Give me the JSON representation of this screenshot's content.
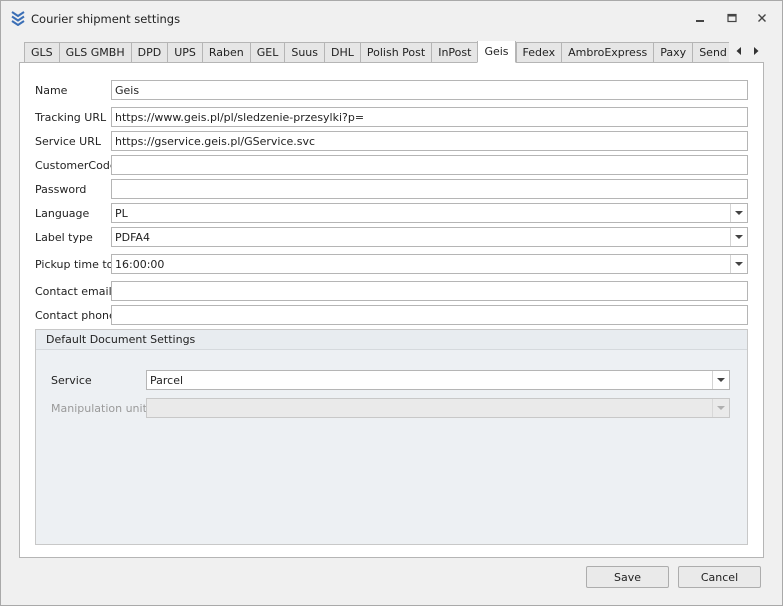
{
  "window": {
    "title": "Courier shipment settings",
    "icon": "chevron-stack-icon",
    "accent": "#3b6fb6"
  },
  "tabs": [
    {
      "label": "GLS"
    },
    {
      "label": "GLS GMBH"
    },
    {
      "label": "DPD"
    },
    {
      "label": "UPS"
    },
    {
      "label": "Raben"
    },
    {
      "label": "GEL"
    },
    {
      "label": "Suus"
    },
    {
      "label": "DHL"
    },
    {
      "label": "Polish Post"
    },
    {
      "label": "InPost"
    },
    {
      "label": "Geis",
      "active": true
    },
    {
      "label": "Fedex"
    },
    {
      "label": "AmbroExpress"
    },
    {
      "label": "Paxy"
    },
    {
      "label": "Send notifi"
    }
  ],
  "form": {
    "name": {
      "label": "Name",
      "value": "Geis"
    },
    "tracking_url": {
      "label": "Tracking URL",
      "value": "https://www.geis.pl/pl/sledzenie-przesylki?p="
    },
    "service_url": {
      "label": "Service URL",
      "value": "https://gservice.geis.pl/GService.svc"
    },
    "customer_code": {
      "label": "CustomerCode",
      "value": ""
    },
    "password": {
      "label": "Password",
      "value": ""
    },
    "language": {
      "label": "Language",
      "value": "PL"
    },
    "label_type": {
      "label": "Label type",
      "value": "PDFA4"
    },
    "pickup_time": {
      "label": "Pickup time to",
      "value": "16:00:00"
    },
    "contact_email": {
      "label": "Contact email",
      "value": ""
    },
    "contact_phone": {
      "label": "Contact phone",
      "value": ""
    }
  },
  "document_settings": {
    "header": "Default Document Settings",
    "service": {
      "label": "Service",
      "value": "Parcel"
    },
    "manipulation_units": {
      "label": "Manipulation units",
      "value": ""
    }
  },
  "buttons": {
    "save": "Save",
    "cancel": "Cancel"
  }
}
